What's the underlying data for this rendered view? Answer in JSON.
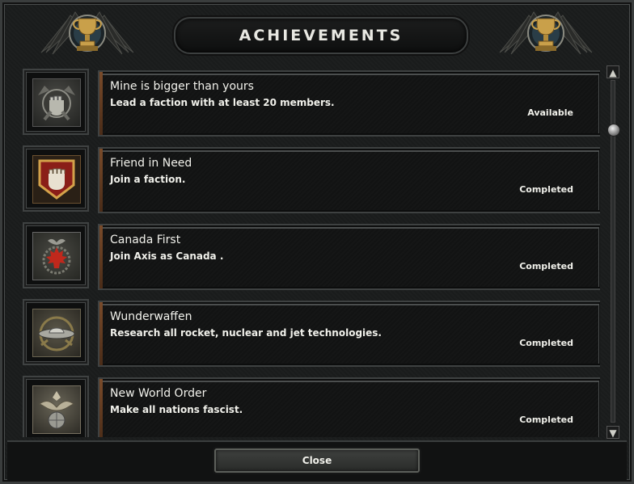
{
  "window": {
    "title": "ACHIEVEMENTS"
  },
  "icons": {
    "header_left": "trophy-wreath-emblem",
    "header_right": "trophy-wreath-emblem",
    "scroll_up": "▲",
    "scroll_down": "▼"
  },
  "achievements": [
    {
      "title": "Mine is bigger than yours",
      "description": "Lead a faction with at least 20 members.",
      "status": "Available",
      "icon": "fist-emblem-grey"
    },
    {
      "title": "Friend in Need",
      "description": "Join a faction.",
      "status": "Completed",
      "icon": "fist-shield-red"
    },
    {
      "title": "Canada First",
      "description": "Join Axis as Canada .",
      "status": "Completed",
      "icon": "maple-leaf-eagle"
    },
    {
      "title": "Wunderwaffen",
      "description": "Research all rocket, nuclear and jet technologies.",
      "status": "Completed",
      "icon": "flying-saucer-wreath"
    },
    {
      "title": "New World Order",
      "description": "Make all nations fascist.",
      "status": "Completed",
      "icon": "eagle-globe"
    }
  ],
  "footer": {
    "close_label": "Close"
  },
  "colors": {
    "background": "#1a1c1c",
    "text": "#f0f0ea",
    "accent_bronze": "#7a4b2a"
  }
}
